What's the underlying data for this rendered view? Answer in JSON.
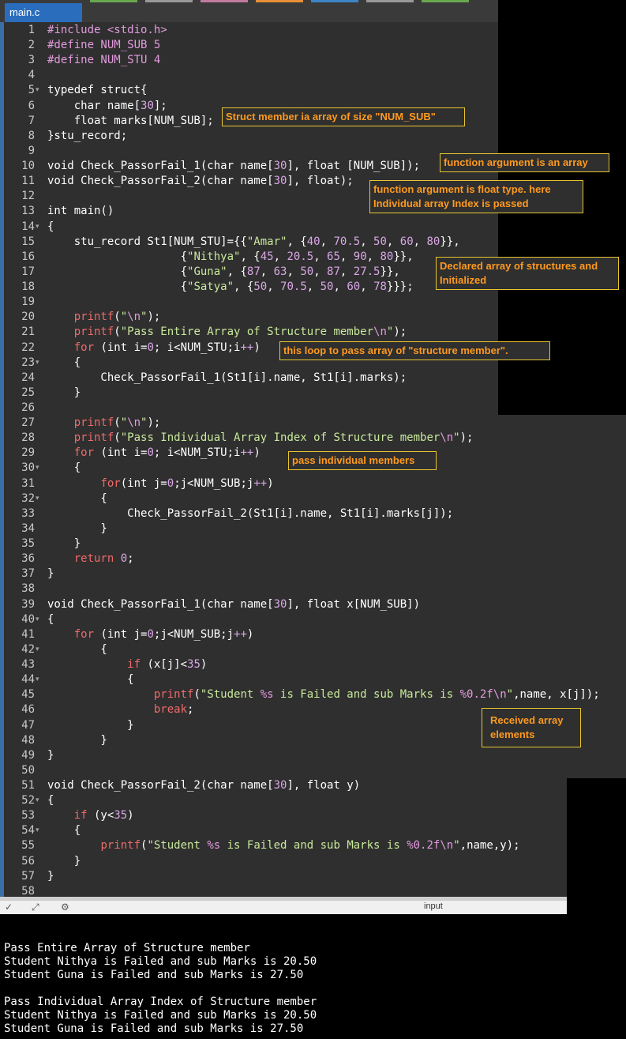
{
  "tab": {
    "title": "main.c"
  },
  "lines": [
    [
      "1",
      "",
      "<span class=\"p\">#include &lt;stdio.h&gt;</span>"
    ],
    [
      "2",
      "",
      "<span class=\"p\">#define NUM_SUB 5</span>"
    ],
    [
      "3",
      "",
      "<span class=\"p\">#define NUM_STU 4</span>"
    ],
    [
      "4",
      "",
      ""
    ],
    [
      "5",
      "▾",
      "typedef struct{"
    ],
    [
      "6",
      "",
      "    char name[<span class=\"n\">30</span>];"
    ],
    [
      "7",
      "",
      "    float marks[NUM_SUB];"
    ],
    [
      "8",
      "",
      "}stu_record;"
    ],
    [
      "9",
      "",
      ""
    ],
    [
      "10",
      "",
      "void Check_PassorFail_1(char name[<span class=\"n\">30</span>], float [NUM_SUB]);"
    ],
    [
      "11",
      "",
      "void Check_PassorFail_2(char name[<span class=\"n\">30</span>], float);"
    ],
    [
      "12",
      "",
      ""
    ],
    [
      "13",
      "",
      "int main()"
    ],
    [
      "14",
      "▾",
      "{"
    ],
    [
      "15",
      "",
      "    stu_record St1[NUM_STU]={{<span class=\"s\">\"Amar\"</span>, {<span class=\"n\">40</span>, <span class=\"n\">70.5</span>, <span class=\"n\">50</span>, <span class=\"n\">60</span>, <span class=\"n\">80</span>}},"
    ],
    [
      "16",
      "",
      "                    {<span class=\"s\">\"Nithya\"</span>, {<span class=\"n\">45</span>, <span class=\"n\">20.5</span>, <span class=\"n\">65</span>, <span class=\"n\">90</span>, <span class=\"n\">80</span>}},"
    ],
    [
      "17",
      "",
      "                    {<span class=\"s\">\"Guna\"</span>, {<span class=\"n\">87</span>, <span class=\"n\">63</span>, <span class=\"n\">50</span>, <span class=\"n\">87</span>, <span class=\"n\">27.5</span>}},"
    ],
    [
      "18",
      "",
      "                    {<span class=\"s\">\"Satya\"</span>, {<span class=\"n\">50</span>, <span class=\"n\">70.5</span>, <span class=\"n\">50</span>, <span class=\"n\">60</span>, <span class=\"n\">78</span>}}};"
    ],
    [
      "19",
      "",
      ""
    ],
    [
      "20",
      "",
      "    <span class=\"f\">printf</span>(<span class=\"s\">\"<span class=\"e\">\\n</span>\"</span>);"
    ],
    [
      "21",
      "",
      "    <span class=\"f\">printf</span>(<span class=\"s\">\"Pass Entire Array of Structure member<span class=\"e\">\\n</span>\"</span>);"
    ],
    [
      "22",
      "",
      "    <span class=\"f\">for</span> (int i=<span class=\"n\">0</span>; i&lt;NUM_STU;i<span class=\"n\">++</span>)"
    ],
    [
      "23",
      "▾",
      "    {"
    ],
    [
      "24",
      "",
      "        Check_PassorFail_1(St1[i].name, St1[i].marks);"
    ],
    [
      "25",
      "",
      "    }"
    ],
    [
      "26",
      "",
      ""
    ],
    [
      "27",
      "",
      "    <span class=\"f\">printf</span>(<span class=\"s\">\"<span class=\"e\">\\n</span>\"</span>);"
    ],
    [
      "28",
      "",
      "    <span class=\"f\">printf</span>(<span class=\"s\">\"Pass Individual Array Index of Structure member<span class=\"e\">\\n</span>\"</span>);"
    ],
    [
      "29",
      "",
      "    <span class=\"f\">for</span> (int i=<span class=\"n\">0</span>; i&lt;NUM_STU;i<span class=\"n\">++</span>)"
    ],
    [
      "30",
      "▾",
      "    {"
    ],
    [
      "31",
      "",
      "        <span class=\"f\">for</span>(int j=<span class=\"n\">0</span>;j&lt;NUM_SUB;j<span class=\"n\">++</span>)"
    ],
    [
      "32",
      "▾",
      "        {"
    ],
    [
      "33",
      "",
      "            Check_PassorFail_2(St1[i].name, St1[i].marks[j]);"
    ],
    [
      "34",
      "",
      "        }"
    ],
    [
      "35",
      "",
      "    }"
    ],
    [
      "36",
      "",
      "    <span class=\"f\">return</span> <span class=\"n\">0</span>;"
    ],
    [
      "37",
      "",
      "}"
    ],
    [
      "38",
      "",
      ""
    ],
    [
      "39",
      "",
      "void Check_PassorFail_1(char name[<span class=\"n\">30</span>], float x[NUM_SUB])"
    ],
    [
      "40",
      "▾",
      "{"
    ],
    [
      "41",
      "",
      "    <span class=\"f\">for</span> (int j=<span class=\"n\">0</span>;j&lt;NUM_SUB;j<span class=\"n\">++</span>)"
    ],
    [
      "42",
      "▾",
      "        {"
    ],
    [
      "43",
      "",
      "            <span class=\"f\">if</span> (x[j]&lt;<span class=\"n\">35</span>)"
    ],
    [
      "44",
      "▾",
      "            {"
    ],
    [
      "45",
      "",
      "                <span class=\"f\">printf</span>(<span class=\"s\">\"Student <span class=\"e\">%s</span> is Failed and sub Marks is <span class=\"e\">%0.2f</span><span class=\"e\">\\n</span>\"</span>,name, x[j]);"
    ],
    [
      "46",
      "",
      "                <span class=\"f\">break</span>;"
    ],
    [
      "47",
      "",
      "            }"
    ],
    [
      "48",
      "",
      "        }"
    ],
    [
      "49",
      "",
      "}"
    ],
    [
      "50",
      "",
      ""
    ],
    [
      "51",
      "",
      "void Check_PassorFail_2(char name[<span class=\"n\">30</span>], float y)"
    ],
    [
      "52",
      "▾",
      "{"
    ],
    [
      "53",
      "",
      "    <span class=\"f\">if</span> (y&lt;<span class=\"n\">35</span>)"
    ],
    [
      "54",
      "▾",
      "    {"
    ],
    [
      "55",
      "",
      "        <span class=\"f\">printf</span>(<span class=\"s\">\"Student <span class=\"e\">%s</span> is Failed and sub Marks is <span class=\"e\">%0.2f</span><span class=\"e\">\\n</span>\"</span>,name,y);"
    ],
    [
      "56",
      "",
      "    }"
    ],
    [
      "57",
      "",
      "}"
    ],
    [
      "58",
      "",
      ""
    ]
  ],
  "annotations": [
    "Struct member ia array of size \"NUM_SUB\"",
    "function argument is an array",
    "function argument is float type. here Individual array Index is passed",
    "Declared array of structures and Initialized",
    "this loop to pass array of \"structure member\".",
    "pass individual members",
    "Received array elements"
  ],
  "toolbar": {
    "input_label": "input"
  },
  "console": [
    "",
    "Pass Entire Array of Structure member",
    "Student Nithya is Failed and sub Marks is 20.50",
    "Student Guna is Failed and sub Marks is 27.50",
    "",
    "Pass Individual Array Index of Structure member",
    "Student Nithya is Failed and sub Marks is 20.50",
    "Student Guna is Failed and sub Marks is 27.50"
  ]
}
